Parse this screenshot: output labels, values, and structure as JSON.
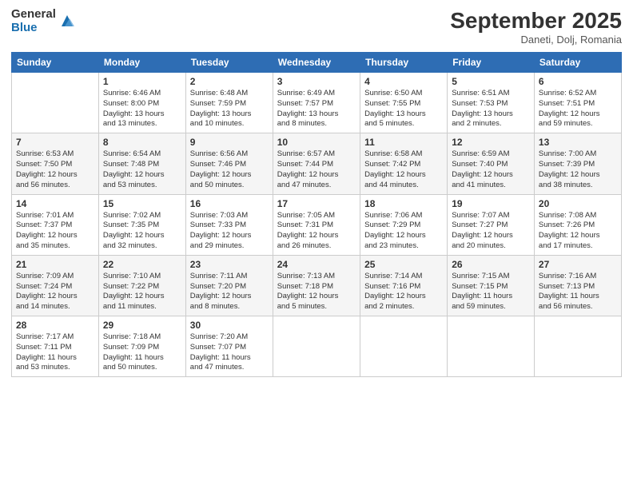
{
  "logo": {
    "general": "General",
    "blue": "Blue"
  },
  "header": {
    "month": "September 2025",
    "location": "Daneti, Dolj, Romania"
  },
  "weekdays": [
    "Sunday",
    "Monday",
    "Tuesday",
    "Wednesday",
    "Thursday",
    "Friday",
    "Saturday"
  ],
  "weeks": [
    [
      {
        "day": "",
        "info": ""
      },
      {
        "day": "1",
        "info": "Sunrise: 6:46 AM\nSunset: 8:00 PM\nDaylight: 13 hours\nand 13 minutes."
      },
      {
        "day": "2",
        "info": "Sunrise: 6:48 AM\nSunset: 7:59 PM\nDaylight: 13 hours\nand 10 minutes."
      },
      {
        "day": "3",
        "info": "Sunrise: 6:49 AM\nSunset: 7:57 PM\nDaylight: 13 hours\nand 8 minutes."
      },
      {
        "day": "4",
        "info": "Sunrise: 6:50 AM\nSunset: 7:55 PM\nDaylight: 13 hours\nand 5 minutes."
      },
      {
        "day": "5",
        "info": "Sunrise: 6:51 AM\nSunset: 7:53 PM\nDaylight: 13 hours\nand 2 minutes."
      },
      {
        "day": "6",
        "info": "Sunrise: 6:52 AM\nSunset: 7:51 PM\nDaylight: 12 hours\nand 59 minutes."
      }
    ],
    [
      {
        "day": "7",
        "info": "Sunrise: 6:53 AM\nSunset: 7:50 PM\nDaylight: 12 hours\nand 56 minutes."
      },
      {
        "day": "8",
        "info": "Sunrise: 6:54 AM\nSunset: 7:48 PM\nDaylight: 12 hours\nand 53 minutes."
      },
      {
        "day": "9",
        "info": "Sunrise: 6:56 AM\nSunset: 7:46 PM\nDaylight: 12 hours\nand 50 minutes."
      },
      {
        "day": "10",
        "info": "Sunrise: 6:57 AM\nSunset: 7:44 PM\nDaylight: 12 hours\nand 47 minutes."
      },
      {
        "day": "11",
        "info": "Sunrise: 6:58 AM\nSunset: 7:42 PM\nDaylight: 12 hours\nand 44 minutes."
      },
      {
        "day": "12",
        "info": "Sunrise: 6:59 AM\nSunset: 7:40 PM\nDaylight: 12 hours\nand 41 minutes."
      },
      {
        "day": "13",
        "info": "Sunrise: 7:00 AM\nSunset: 7:39 PM\nDaylight: 12 hours\nand 38 minutes."
      }
    ],
    [
      {
        "day": "14",
        "info": "Sunrise: 7:01 AM\nSunset: 7:37 PM\nDaylight: 12 hours\nand 35 minutes."
      },
      {
        "day": "15",
        "info": "Sunrise: 7:02 AM\nSunset: 7:35 PM\nDaylight: 12 hours\nand 32 minutes."
      },
      {
        "day": "16",
        "info": "Sunrise: 7:03 AM\nSunset: 7:33 PM\nDaylight: 12 hours\nand 29 minutes."
      },
      {
        "day": "17",
        "info": "Sunrise: 7:05 AM\nSunset: 7:31 PM\nDaylight: 12 hours\nand 26 minutes."
      },
      {
        "day": "18",
        "info": "Sunrise: 7:06 AM\nSunset: 7:29 PM\nDaylight: 12 hours\nand 23 minutes."
      },
      {
        "day": "19",
        "info": "Sunrise: 7:07 AM\nSunset: 7:27 PM\nDaylight: 12 hours\nand 20 minutes."
      },
      {
        "day": "20",
        "info": "Sunrise: 7:08 AM\nSunset: 7:26 PM\nDaylight: 12 hours\nand 17 minutes."
      }
    ],
    [
      {
        "day": "21",
        "info": "Sunrise: 7:09 AM\nSunset: 7:24 PM\nDaylight: 12 hours\nand 14 minutes."
      },
      {
        "day": "22",
        "info": "Sunrise: 7:10 AM\nSunset: 7:22 PM\nDaylight: 12 hours\nand 11 minutes."
      },
      {
        "day": "23",
        "info": "Sunrise: 7:11 AM\nSunset: 7:20 PM\nDaylight: 12 hours\nand 8 minutes."
      },
      {
        "day": "24",
        "info": "Sunrise: 7:13 AM\nSunset: 7:18 PM\nDaylight: 12 hours\nand 5 minutes."
      },
      {
        "day": "25",
        "info": "Sunrise: 7:14 AM\nSunset: 7:16 PM\nDaylight: 12 hours\nand 2 minutes."
      },
      {
        "day": "26",
        "info": "Sunrise: 7:15 AM\nSunset: 7:15 PM\nDaylight: 11 hours\nand 59 minutes."
      },
      {
        "day": "27",
        "info": "Sunrise: 7:16 AM\nSunset: 7:13 PM\nDaylight: 11 hours\nand 56 minutes."
      }
    ],
    [
      {
        "day": "28",
        "info": "Sunrise: 7:17 AM\nSunset: 7:11 PM\nDaylight: 11 hours\nand 53 minutes."
      },
      {
        "day": "29",
        "info": "Sunrise: 7:18 AM\nSunset: 7:09 PM\nDaylight: 11 hours\nand 50 minutes."
      },
      {
        "day": "30",
        "info": "Sunrise: 7:20 AM\nSunset: 7:07 PM\nDaylight: 11 hours\nand 47 minutes."
      },
      {
        "day": "",
        "info": ""
      },
      {
        "day": "",
        "info": ""
      },
      {
        "day": "",
        "info": ""
      },
      {
        "day": "",
        "info": ""
      }
    ]
  ]
}
